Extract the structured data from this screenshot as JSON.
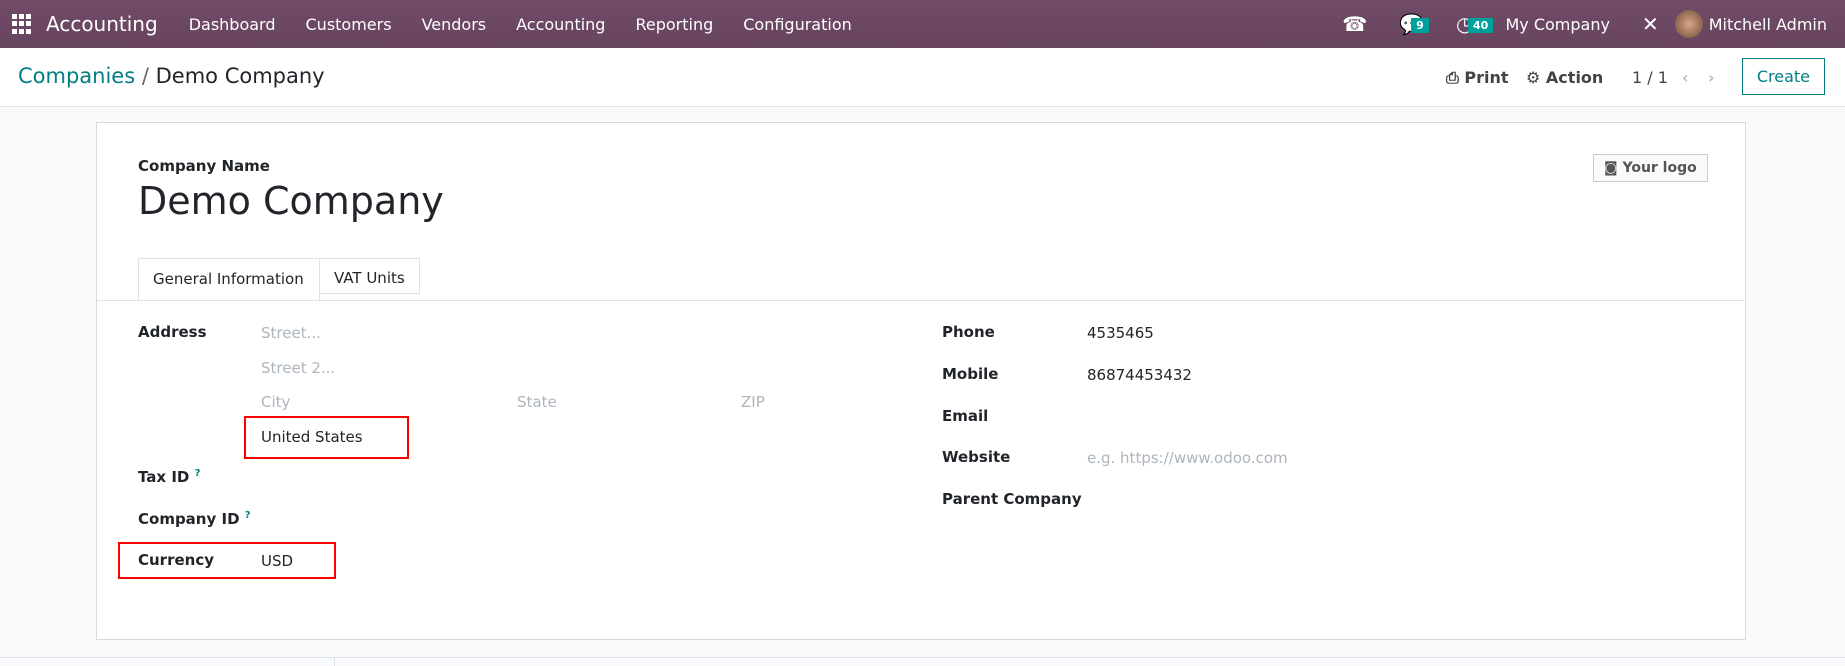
{
  "navbar": {
    "app": "Accounting",
    "menus": [
      "Dashboard",
      "Customers",
      "Vendors",
      "Accounting",
      "Reporting",
      "Configuration"
    ],
    "messages_count": "9",
    "activities_count": "40",
    "company": "My Company",
    "user": "Mitchell Admin"
  },
  "control": {
    "breadcrumb_parent": "Companies",
    "breadcrumb_current": "Demo Company",
    "print": "Print",
    "action": "Action",
    "pager": "1 / 1",
    "create": "Create"
  },
  "form": {
    "company_name_label": "Company Name",
    "company_name": "Demo Company",
    "logo_button": "Your logo",
    "tabs": [
      "General Information",
      "VAT Units"
    ],
    "address_label": "Address",
    "street_ph": "Street...",
    "street2_ph": "Street 2...",
    "city_ph": "City",
    "state_ph": "State",
    "zip_ph": "ZIP",
    "country": "United States",
    "tax_id_label": "Tax ID",
    "company_id_label": "Company ID",
    "help": "?",
    "currency_label": "Currency",
    "currency": "USD",
    "phone_label": "Phone",
    "phone": "4535465",
    "mobile_label": "Mobile",
    "mobile": "86874453432",
    "email_label": "Email",
    "website_label": "Website",
    "website_ph": "e.g. https://www.odoo.com",
    "parent_label": "Parent Company"
  }
}
